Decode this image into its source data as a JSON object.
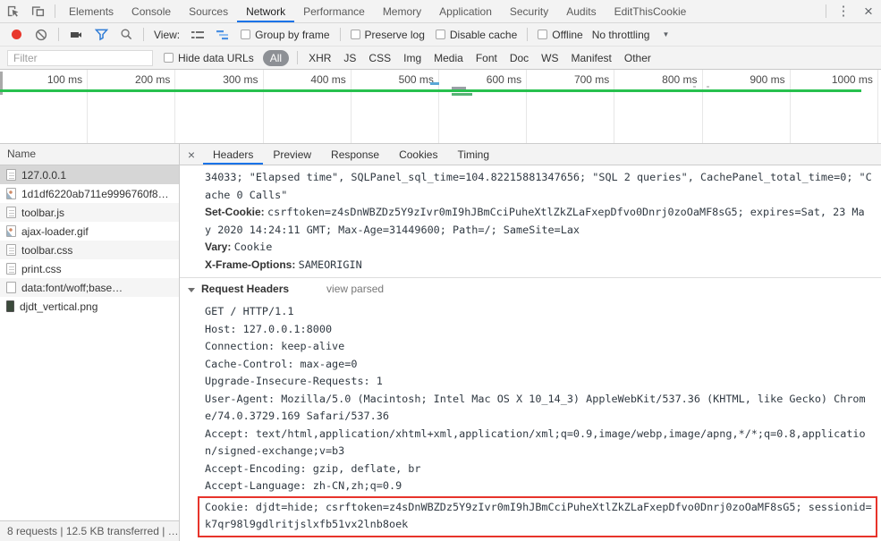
{
  "tabbar": {
    "tabs": [
      "Elements",
      "Console",
      "Sources",
      "Network",
      "Performance",
      "Memory",
      "Application",
      "Security",
      "Audits",
      "EditThisCookie"
    ],
    "active": "Network",
    "kebab": "⋮",
    "close": "×"
  },
  "toolbar": {
    "view_label": "View:",
    "group_by_frame": "Group by frame",
    "preserve_log": "Preserve log",
    "disable_cache": "Disable cache",
    "offline": "Offline",
    "throttling": "No throttling",
    "dropdown_arrow": "▼"
  },
  "filterbar": {
    "placeholder": "Filter",
    "hide_data_urls": "Hide data URLs",
    "all_pill": "All",
    "types": [
      "XHR",
      "JS",
      "CSS",
      "Img",
      "Media",
      "Font",
      "Doc",
      "WS",
      "Manifest",
      "Other"
    ]
  },
  "timeline": {
    "ticks": [
      "100 ms",
      "200 ms",
      "300 ms",
      "400 ms",
      "500 ms",
      "600 ms",
      "700 ms",
      "800 ms",
      "900 ms",
      "1000 ms"
    ]
  },
  "sidebar": {
    "header": "Name",
    "items": [
      {
        "label": "127.0.0.1",
        "icon": "doc",
        "selected": true
      },
      {
        "label": "1d1df6220ab711e9996760f8…",
        "icon": "img"
      },
      {
        "label": "toolbar.js",
        "icon": "doc"
      },
      {
        "label": "ajax-loader.gif",
        "icon": "img"
      },
      {
        "label": "toolbar.css",
        "icon": "doc"
      },
      {
        "label": "print.css",
        "icon": "doc"
      },
      {
        "label": "data:font/woff;base…",
        "icon": "blank"
      },
      {
        "label": "djdt_vertical.png",
        "icon": "thumb"
      }
    ]
  },
  "details": {
    "close": "×",
    "tabs": [
      "Headers",
      "Preview",
      "Response",
      "Cookies",
      "Timing"
    ],
    "active": "Headers",
    "lines": [
      {
        "t": "mono",
        "text": "34033; \"Elapsed time\", SQLPanel_sql_time=104.82215881347656; \"SQL 2 queries\", CachePanel_total_time=0; \"C"
      },
      {
        "t": "mono",
        "text": "ache 0 Calls\""
      },
      {
        "t": "header",
        "name": "Set-Cookie:",
        "value": "csrftoken=z4sDnWBZDz5Y9zIvr0mI9hJBmCciPuheXtlZkZLaFxepDfvo0Dnrj0zoOaMF8sG5; expires=Sat, 23 Ma"
      },
      {
        "t": "mono",
        "text": "y 2020 14:24:11 GMT; Max-Age=31449600; Path=/; SameSite=Lax"
      },
      {
        "t": "header",
        "name": "Vary:",
        "value": "Cookie"
      },
      {
        "t": "header",
        "name": "X-Frame-Options:",
        "value": "SAMEORIGIN"
      },
      {
        "t": "section",
        "name": "Request Headers",
        "link": "view parsed"
      },
      {
        "t": "mono",
        "text": "GET / HTTP/1.1"
      },
      {
        "t": "mono",
        "text": "Host: 127.0.0.1:8000"
      },
      {
        "t": "mono",
        "text": "Connection: keep-alive"
      },
      {
        "t": "mono",
        "text": "Cache-Control: max-age=0"
      },
      {
        "t": "mono",
        "text": "Upgrade-Insecure-Requests: 1"
      },
      {
        "t": "mono",
        "text": "User-Agent: Mozilla/5.0 (Macintosh; Intel Mac OS X 10_14_3) AppleWebKit/537.36 (KHTML, like Gecko) Chrom"
      },
      {
        "t": "mono",
        "text": "e/74.0.3729.169 Safari/537.36"
      },
      {
        "t": "mono",
        "text": "Accept: text/html,application/xhtml+xml,application/xml;q=0.9,image/webp,image/apng,*/*;q=0.8,applicatio"
      },
      {
        "t": "mono",
        "text": "n/signed-exchange;v=b3"
      },
      {
        "t": "mono",
        "text": "Accept-Encoding: gzip, deflate, br"
      },
      {
        "t": "mono",
        "text": "Accept-Language: zh-CN,zh;q=0.9"
      },
      {
        "t": "mono",
        "highlight": true,
        "text": "Cookie: djdt=hide; csrftoken=z4sDnWBZDz5Y9zIvr0mI9hJBmCciPuheXtlZkZLaFxepDfvo0Dnrj0zoOaMF8sG5; sessionid="
      },
      {
        "t": "mono",
        "highlight": true,
        "text": "k7qr98l9gdlritjslxfb51vx2lnb8oek"
      }
    ]
  },
  "statusbar": {
    "text": "8 requests | 12.5 KB transferred | …"
  }
}
